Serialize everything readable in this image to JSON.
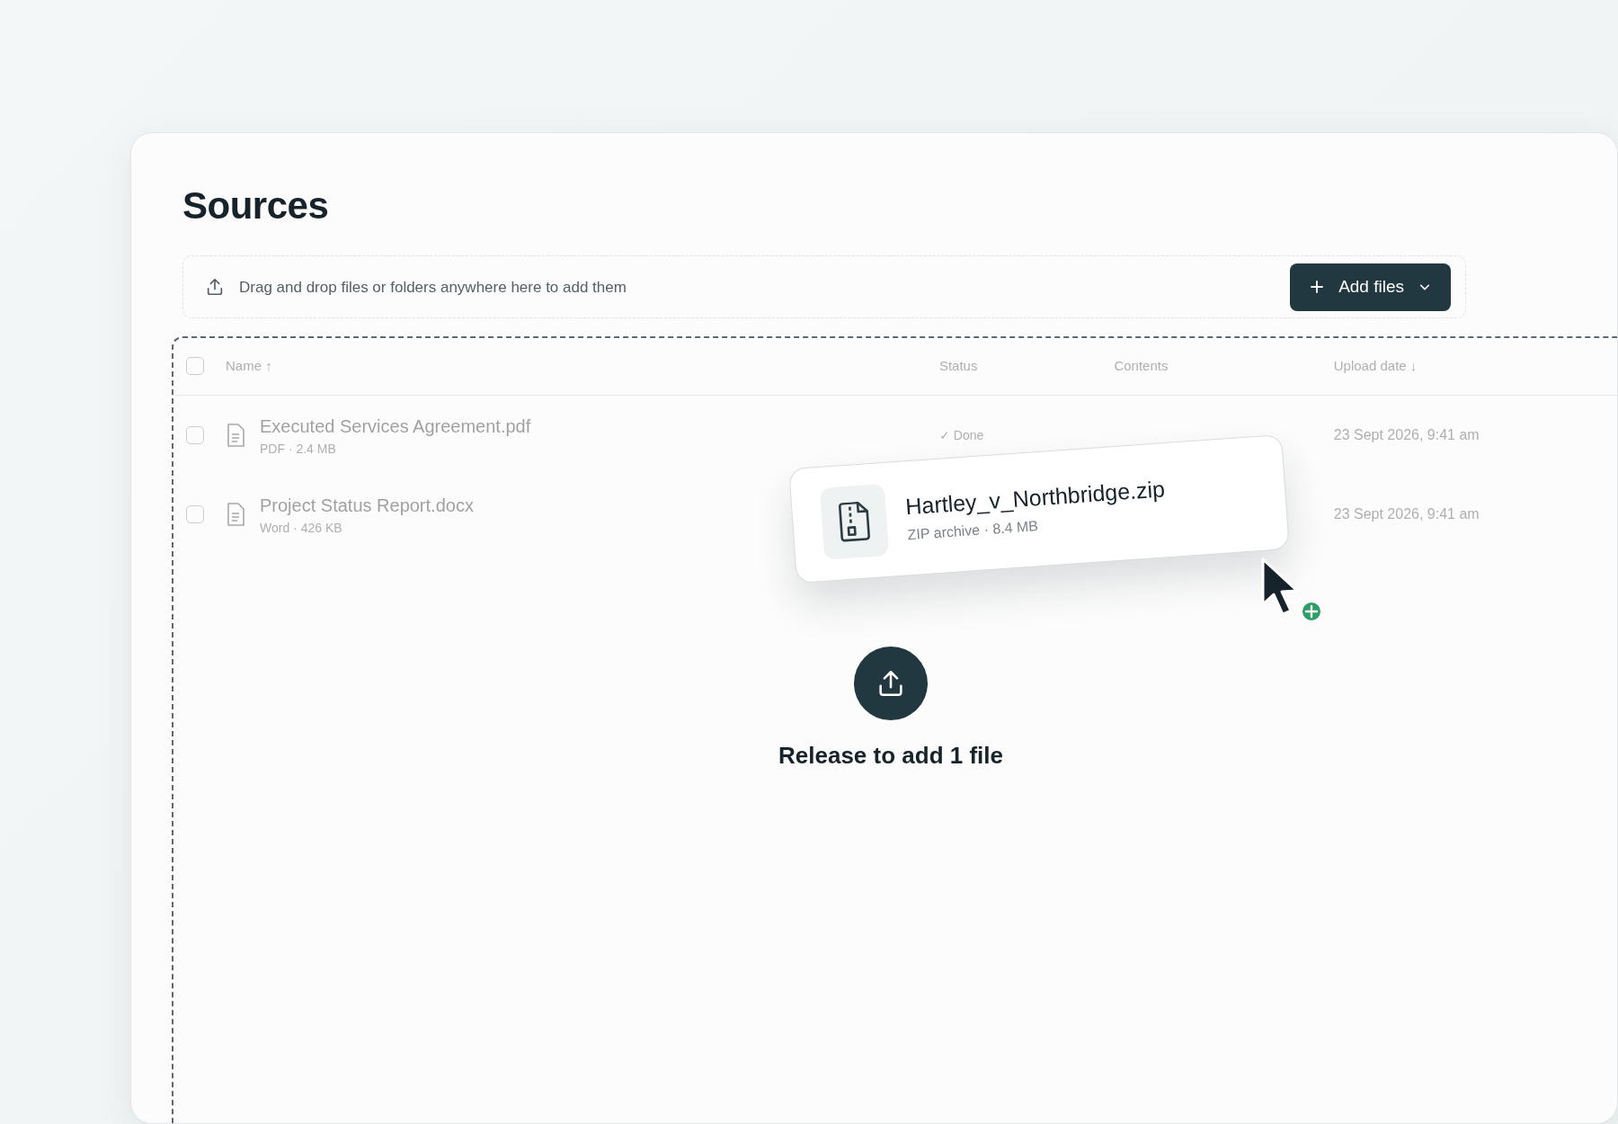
{
  "title": "Sources",
  "dropzone": {
    "hint": "Drag and drop files or folders anywhere here to add them",
    "button": "Add files"
  },
  "table": {
    "select_all": {
      "checked": false
    },
    "columns": [
      "Name ↑",
      "Status",
      "Contents",
      "Upload date ↓"
    ],
    "rows": [
      {
        "checked": false,
        "name": "Executed Services Agreement.pdf",
        "meta": "PDF · 2.4 MB",
        "status": "✓ Done",
        "date": "23 Sept 2026, 9:41 am"
      },
      {
        "checked": false,
        "name": "Project Status Report.docx",
        "meta": "Word · 426 KB",
        "date": "23 Sept 2026, 9:41 am"
      }
    ]
  },
  "drag_card": {
    "name": "Hartley_v_Northbridge.zip",
    "meta": "ZIP archive · 8.4 MB"
  },
  "release_text": "Release to add 1 file"
}
